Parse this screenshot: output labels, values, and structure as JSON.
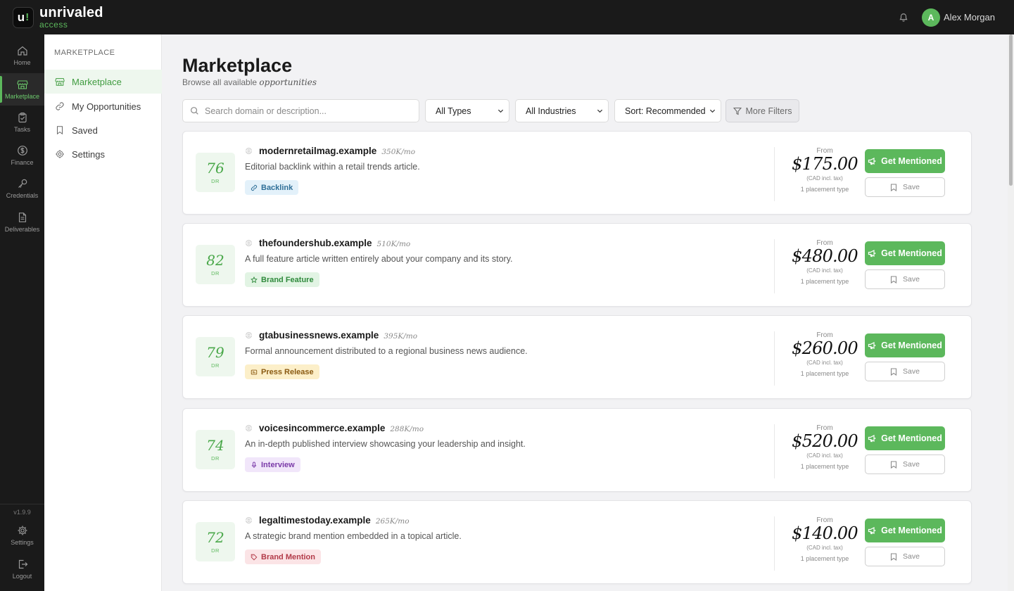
{
  "app": {
    "logo_mark": "u",
    "logo_bang": "!",
    "name": "unrivaled",
    "subname": "access"
  },
  "user": {
    "initial": "A",
    "name": "Alex Morgan"
  },
  "rail": {
    "items": [
      {
        "label": "Home",
        "icon": "home-icon"
      },
      {
        "label": "Marketplace",
        "icon": "storefront-icon",
        "active": true
      },
      {
        "label": "Tasks",
        "icon": "clipboard-icon"
      },
      {
        "label": "Finance",
        "icon": "dollar-icon"
      },
      {
        "label": "Credentials",
        "icon": "key-icon"
      },
      {
        "label": "Deliverables",
        "icon": "document-icon"
      }
    ],
    "version": "v1.9.9",
    "settings_label": "Settings",
    "logout_label": "Logout"
  },
  "subnav": {
    "title": "MARKETPLACE",
    "items": [
      {
        "label": "Marketplace",
        "icon": "storefront-icon",
        "active": true
      },
      {
        "label": "My Opportunities",
        "icon": "link-icon"
      },
      {
        "label": "Saved",
        "icon": "bookmark-icon"
      },
      {
        "label": "Settings",
        "icon": "gear-icon"
      }
    ]
  },
  "page": {
    "title": "Marketplace",
    "subtitle_prefix": "Browse all available",
    "subtitle_emph": "opportunities"
  },
  "filters": {
    "search_placeholder": "Search domain or description...",
    "type": "All Types",
    "industry": "All Industries",
    "sort": "Sort: Recommended",
    "more": "More Filters"
  },
  "labels": {
    "dr": "DR",
    "from": "From",
    "tax": "(CAD incl. tax)",
    "placement": "1 placement type",
    "get": "Get Mentioned",
    "save": "Save"
  },
  "listings": [
    {
      "dr": "76",
      "domain": "modernretailmag.example",
      "traffic": "350K/mo",
      "description": "Editorial backlink within a retail trends article.",
      "tag": "Backlink",
      "tag_icon": "link-icon",
      "tag_bg": "#e3f1fa",
      "tag_color": "#2f6f98",
      "price": "$175.00"
    },
    {
      "dr": "82",
      "domain": "thefoundershub.example",
      "traffic": "510K/mo",
      "description": "A full feature article written entirely about your company and its story.",
      "tag": "Brand Feature",
      "tag_icon": "star-icon",
      "tag_bg": "#e2f4e4",
      "tag_color": "#2f8a3c",
      "price": "$480.00"
    },
    {
      "dr": "79",
      "domain": "gtabusinessnews.example",
      "traffic": "395K/mo",
      "description": "Formal announcement distributed to a regional business news audience.",
      "tag": "Press Release",
      "tag_icon": "newspaper-icon",
      "tag_bg": "#fcefc9",
      "tag_color": "#8a5a12",
      "price": "$260.00"
    },
    {
      "dr": "74",
      "domain": "voicesincommerce.example",
      "traffic": "288K/mo",
      "description": "An in-depth published interview showcasing your leadership and insight.",
      "tag": "Interview",
      "tag_icon": "microphone-icon",
      "tag_bg": "#f1e6fa",
      "tag_color": "#7a3aa8",
      "price": "$520.00"
    },
    {
      "dr": "72",
      "domain": "legaltimestoday.example",
      "traffic": "265K/mo",
      "description": "A strategic brand mention embedded in a topical article.",
      "tag": "Brand Mention",
      "tag_icon": "tag-icon",
      "tag_bg": "#fbe4e6",
      "tag_color": "#b23a48",
      "price": "$140.00"
    }
  ],
  "colors": {
    "accent": "#5cb85c",
    "dark": "#1a1a1a",
    "page_bg": "#f2f2f4"
  }
}
